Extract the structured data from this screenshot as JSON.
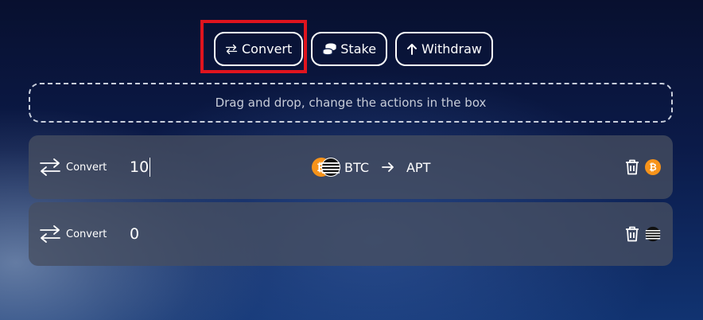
{
  "toolbar": {
    "convert_label": "Convert",
    "stake_label": "Stake",
    "withdraw_label": "Withdraw"
  },
  "dropzone": {
    "text": "Drag and drop, change the actions in the box"
  },
  "actions": [
    {
      "label": "Convert",
      "amount": "10",
      "from_token": "BTC",
      "to_token": "APT",
      "token_icon": "bitcoin-icon"
    },
    {
      "label": "Convert",
      "amount": "0",
      "token_icon": "aptos-icon"
    }
  ],
  "colors": {
    "highlight": "#e0141e",
    "bitcoin": "#f7931a",
    "card_bg": "#464e60"
  }
}
